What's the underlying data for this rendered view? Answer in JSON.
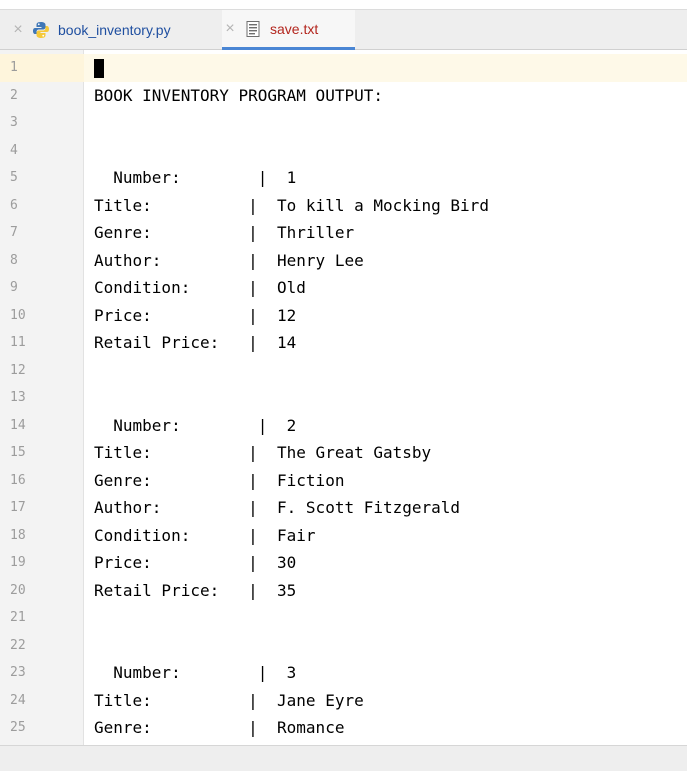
{
  "tabs": [
    {
      "label": "book_inventory.py",
      "icon": "python-file-icon",
      "active": false
    },
    {
      "label": "save.txt",
      "icon": "text-file-icon",
      "active": true
    }
  ],
  "editor": {
    "line_numbers": [
      "1",
      "2",
      "3",
      "4",
      "5",
      "6",
      "7",
      "8",
      "9",
      "10",
      "11",
      "12",
      "13",
      "14",
      "15",
      "16",
      "17",
      "18",
      "19",
      "20",
      "21",
      "22",
      "23",
      "24",
      "25"
    ],
    "lines": [
      "",
      "BOOK INVENTORY PROGRAM OUTPUT:",
      "",
      "",
      "  Number:        |  1",
      "Title:          |  To kill a Mocking Bird",
      "Genre:          |  Thriller",
      "Author:         |  Henry Lee",
      "Condition:      |  Old",
      "Price:          |  12",
      "Retail Price:   |  14",
      "",
      "",
      "  Number:        |  2",
      "Title:          |  The Great Gatsby",
      "Genre:          |  Fiction",
      "Author:         |  F. Scott Fitzgerald",
      "Condition:      |  Fair",
      "Price:          |  30",
      "Retail Price:   |  35",
      "",
      "",
      "  Number:        |  3",
      "Title:          |  Jane Eyre",
      "Genre:          |  Romance"
    ]
  },
  "colors": {
    "active_tab_underline": "#4a86d4",
    "py_tab_text": "#1f4fa0",
    "txt_tab_text": "#b3261e",
    "current_line_highlight": "#fef9e8"
  }
}
